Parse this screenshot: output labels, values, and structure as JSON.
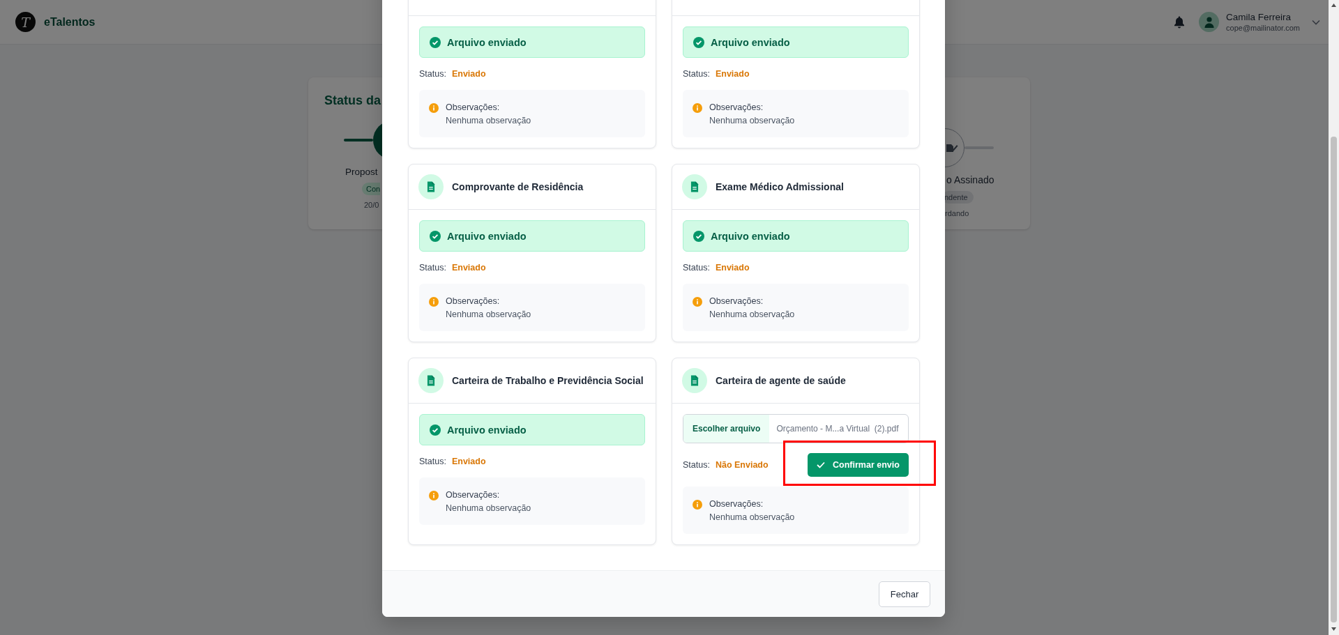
{
  "header": {
    "logo_mark": "T",
    "brand": "eTalentos",
    "user": {
      "name": "Camila Ferreira",
      "email": "cope@mailinator.com"
    }
  },
  "status_card": {
    "title": "Status da",
    "steps": [
      {
        "label": "Propost",
        "badge": "Con",
        "date": "20/0",
        "completed": true
      },
      {
        "label": "o Assinado",
        "badge": "ndente",
        "date": "rdando",
        "completed": false
      }
    ]
  },
  "modal": {
    "documents": [
      {
        "kind": "sent",
        "alert": "Arquivo enviado",
        "status_label": "Status:",
        "status": "Enviado",
        "observations_label": "Observações:",
        "observations": "Nenhuma observação"
      },
      {
        "kind": "sent",
        "alert": "Arquivo enviado",
        "status_label": "Status:",
        "status": "Enviado",
        "observations_label": "Observações:",
        "observations": "Nenhuma observação"
      },
      {
        "kind": "sent",
        "title": "Comprovante de Residência",
        "alert": "Arquivo enviado",
        "status_label": "Status:",
        "status": "Enviado",
        "observations_label": "Observações:",
        "observations": "Nenhuma observação"
      },
      {
        "kind": "sent",
        "title": "Exame Médico Admissional",
        "alert": "Arquivo enviado",
        "status_label": "Status:",
        "status": "Enviado",
        "observations_label": "Observações:",
        "observations": "Nenhuma observação"
      },
      {
        "kind": "sent",
        "title": "Carteira de Trabalho e Previdência Social",
        "alert": "Arquivo enviado",
        "status_label": "Status:",
        "status": "Enviado",
        "observations_label": "Observações:",
        "observations": "Nenhuma observação"
      },
      {
        "kind": "upload",
        "title": "Carteira de agente de saúde",
        "choose_button": "Escolher arquivo",
        "file_name": "Orçamento - M...a Virtual  (2).pdf",
        "status_label": "Status:",
        "status": "Não Enviado",
        "confirm_button": "Confirmar envio",
        "confirm_highlighted": true,
        "observations_label": "Observações:",
        "observations": "Nenhuma observação"
      }
    ],
    "close_button": "Fechar"
  }
}
